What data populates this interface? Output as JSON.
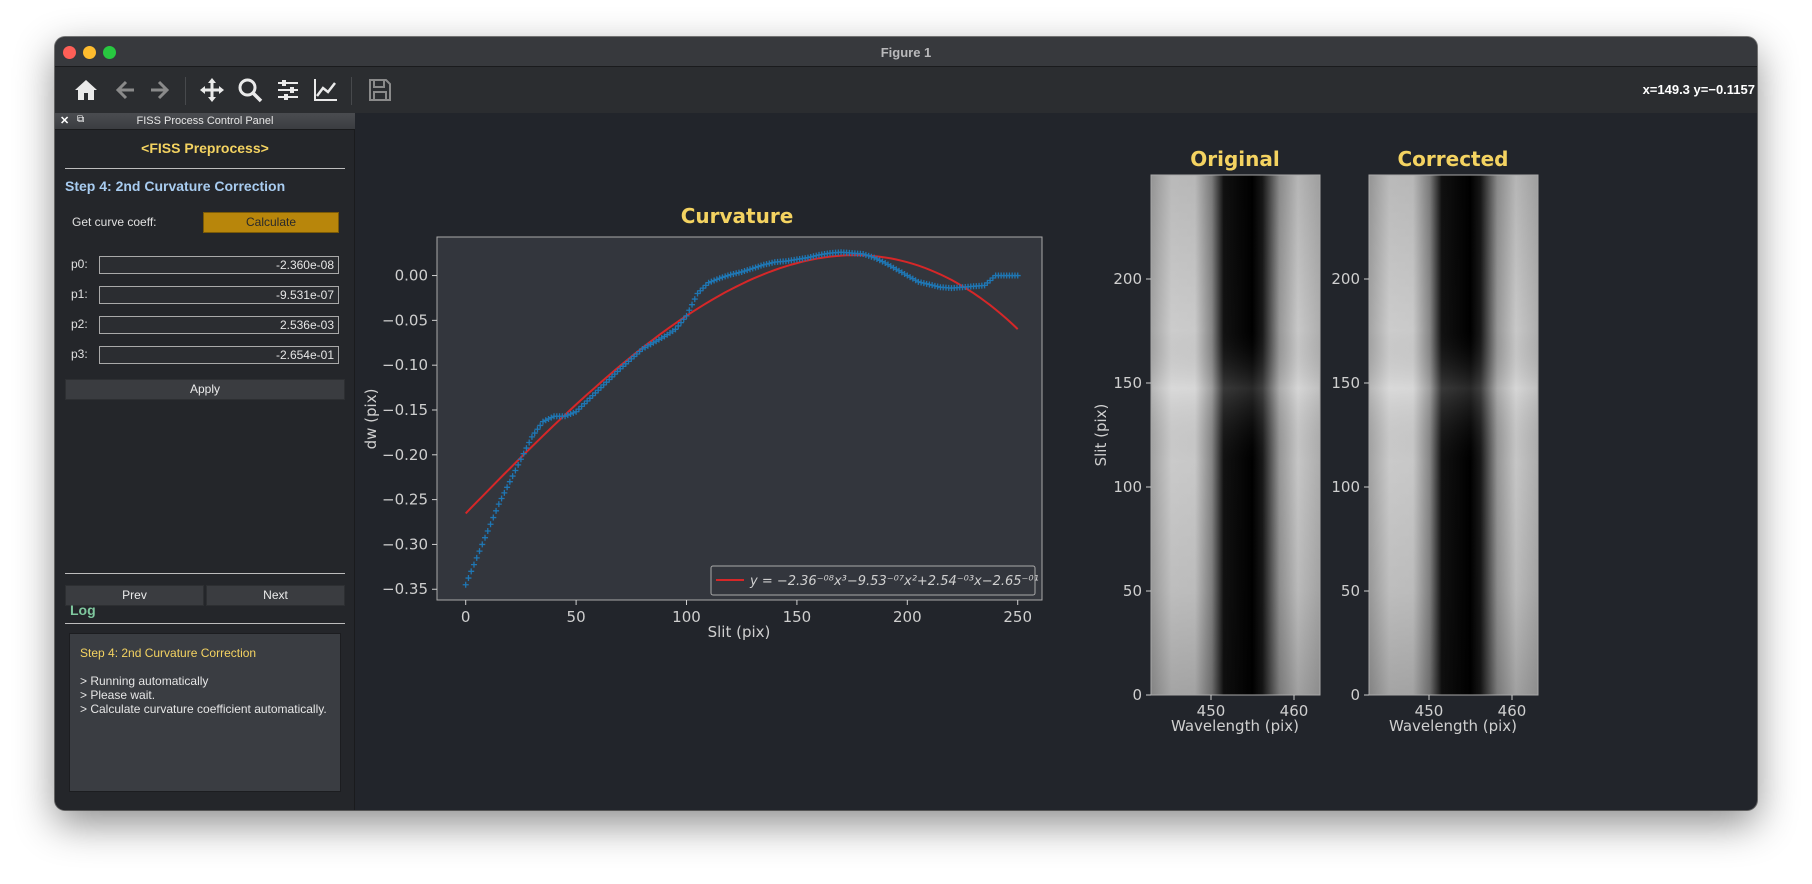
{
  "window": {
    "title": "Figure 1",
    "coords": "x=149.3 y=−0.1157"
  },
  "toolbar": {
    "tools": [
      "home-icon",
      "back-arrow-icon",
      "forward-arrow-icon",
      "pan-move-icon",
      "zoom-magnifier-icon",
      "subplots-sliders-icon",
      "axes-edit-icon",
      "save-disk-icon"
    ]
  },
  "panel": {
    "title": "FISS Process Control Panel",
    "header": "<FISS Preprocess>",
    "step_title": "Step 4: 2nd Curvature Correction",
    "curve_label": "Get curve coeff:",
    "calculate_label": "Calculate",
    "params": [
      {
        "label": "p0:",
        "value": "-2.360e-08"
      },
      {
        "label": "p1:",
        "value": "-9.531e-07"
      },
      {
        "label": "p2:",
        "value": "2.536e-03"
      },
      {
        "label": "p3:",
        "value": "-2.654e-01"
      }
    ],
    "apply_label": "Apply",
    "prev_label": "Prev",
    "next_label": "Next",
    "log_title": "Log",
    "log_header": "Step 4: 2nd Curvature Correction",
    "log_lines": [
      "> Running automatically",
      "> Please wait.",
      "> Calculate curvature coefficient automatically."
    ],
    "accent": "#f4d361",
    "button_color": "#b8860b"
  },
  "chart_data": [
    {
      "type": "scatter",
      "title": "Curvature",
      "xlabel": "Slit (pix)",
      "ylabel": "dw (pix)",
      "xlim": [
        -13,
        261
      ],
      "ylim": [
        -0.362,
        0.043
      ],
      "xticks": [
        "0",
        "50",
        "100",
        "150",
        "200",
        "250"
      ],
      "yticks": [
        "0.00",
        "−0.05",
        "−0.10",
        "−0.15",
        "−0.20",
        "−0.25",
        "−0.30",
        "−0.35"
      ],
      "series": [
        {
          "kind": "points",
          "marker": "+",
          "color": "#1f77b4",
          "x": [
            0,
            5,
            10,
            15,
            20,
            25,
            30,
            35,
            40,
            45,
            50,
            55,
            60,
            65,
            70,
            75,
            80,
            85,
            90,
            95,
            100,
            105,
            110,
            115,
            120,
            125,
            130,
            135,
            140,
            145,
            150,
            155,
            160,
            165,
            170,
            175,
            180,
            185,
            190,
            195,
            200,
            205,
            210,
            215,
            220,
            225,
            230,
            235,
            240,
            245,
            250
          ],
          "y": [
            -0.345,
            -0.315,
            -0.285,
            -0.255,
            -0.23,
            -0.205,
            -0.18,
            -0.163,
            -0.157,
            -0.157,
            -0.152,
            -0.14,
            -0.128,
            -0.116,
            -0.104,
            -0.093,
            -0.082,
            -0.075,
            -0.068,
            -0.06,
            -0.045,
            -0.02,
            -0.008,
            -0.003,
            0.001,
            0.004,
            0.008,
            0.012,
            0.015,
            0.016,
            0.018,
            0.02,
            0.023,
            0.025,
            0.026,
            0.025,
            0.024,
            0.02,
            0.014,
            0.007,
            0.0,
            -0.007,
            -0.01,
            -0.013,
            -0.014,
            -0.013,
            -0.012,
            -0.011,
            0.0,
            0.0,
            0.0
          ]
        },
        {
          "kind": "line",
          "name": "y = −2.36⁻⁰⁸x³−9.53⁻⁰⁷x²+2.54⁻⁰³x−2.65⁻⁰¹",
          "color": "#d62728",
          "coeffs": [
            -2.36e-08,
            -9.531e-07,
            0.002536,
            -0.2654
          ],
          "x_range": [
            0,
            250
          ]
        }
      ],
      "legend": "lower-right",
      "grid": false
    },
    {
      "type": "heatmap",
      "title": "Original",
      "xlabel": "Wavelength (pix)",
      "ylabel": "Slit (pix)",
      "xticks": [
        "450",
        "460"
      ],
      "yticks": [
        "0",
        "50",
        "100",
        "150",
        "200"
      ],
      "colormap": "gray"
    },
    {
      "type": "heatmap",
      "title": "Corrected",
      "xlabel": "Wavelength (pix)",
      "ylabel": "",
      "xticks": [
        "450",
        "460"
      ],
      "yticks": [
        "0",
        "50",
        "100",
        "150",
        "200"
      ],
      "colormap": "gray"
    }
  ]
}
